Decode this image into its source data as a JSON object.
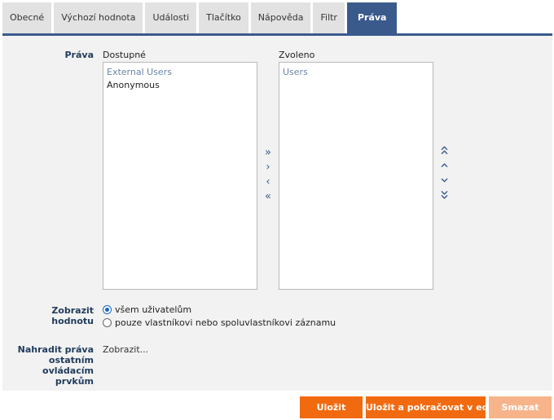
{
  "tabs": [
    {
      "label": "Obecné"
    },
    {
      "label": "Výchozí hodnota"
    },
    {
      "label": "Události"
    },
    {
      "label": "Tlačítko"
    },
    {
      "label": "Nápověda"
    },
    {
      "label": "Filtr"
    },
    {
      "label": "Práva",
      "active": true
    }
  ],
  "rights": {
    "label": "Práva",
    "available": {
      "heading": "Dostupné",
      "items": [
        {
          "text": "External Users",
          "kind": "group"
        },
        {
          "text": "Anonymous",
          "kind": "item"
        }
      ]
    },
    "selected": {
      "heading": "Zvoleno",
      "items": [
        {
          "text": "Users",
          "kind": "group"
        }
      ]
    },
    "transfer_icons": [
      "move-all-right-icon",
      "move-right-icon",
      "move-left-icon",
      "move-all-left-icon"
    ],
    "order_icons": [
      "move-top-icon",
      "move-up-icon",
      "move-down-icon",
      "move-bottom-icon"
    ]
  },
  "show_value": {
    "label": "Zobrazit hodnotu",
    "options": [
      {
        "text": "všem uživatelům",
        "checked": true
      },
      {
        "text": "pouze vlastníkovi nebo spoluvlastníkovi záznamu",
        "checked": false
      }
    ]
  },
  "override_rights": {
    "label_lines": [
      "Nahradit práva",
      "ostatním",
      "ovládacím",
      "prvkům"
    ],
    "link_text": "Zobrazit..."
  },
  "buttons": {
    "save": "Uložit",
    "save_continue": "Uložit a pokračovat v editaci",
    "delete": "Smazat"
  },
  "colors": {
    "accent": "#3a5a8c",
    "button": "#f26a10",
    "button_disabled": "#f7b48a",
    "panel": "#f2f2f2"
  }
}
